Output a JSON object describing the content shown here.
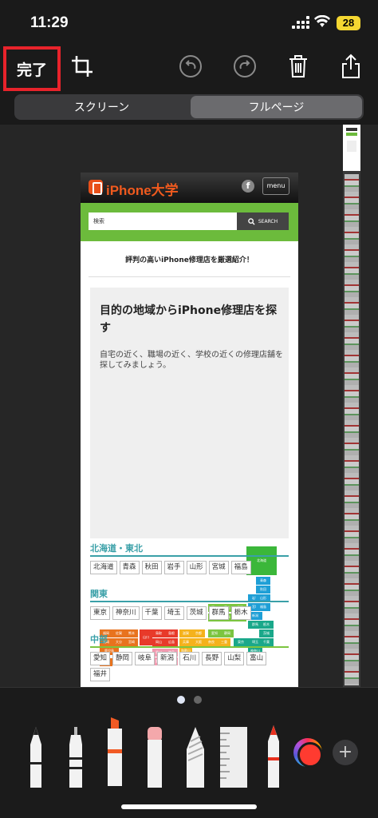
{
  "status_bar": {
    "time": "11:29",
    "battery": "28"
  },
  "toolbar": {
    "done_label": "完了"
  },
  "segments": {
    "screen": "スクリーン",
    "full_page": "フルページ"
  },
  "site": {
    "logo": "iPhone大学",
    "menu_label": "menu",
    "search_placeholder": "検索",
    "search_button": "SEARCH",
    "tagline": "評判の高いiPhone修理店を厳選紹介！",
    "map_title": "目的の地域からiPhone修理店を探す",
    "map_desc": "自宅の近く、職場の近く、学校の近くの修理店舗を探してみましょう。",
    "map_labels": [
      "北海道",
      "青森",
      "秋田",
      "岩手",
      "山形",
      "宮城",
      "福島",
      "新潟",
      "石川",
      "富山",
      "長野",
      "群馬",
      "栃木",
      "茨城",
      "福井",
      "岐阜",
      "山梨",
      "埼玉",
      "千葉",
      "東京",
      "神奈川",
      "静岡",
      "愛知",
      "滋賀",
      "京都",
      "兵庫",
      "大阪",
      "奈良",
      "三重",
      "和歌山",
      "鳥取",
      "島根",
      "岡山",
      "広島",
      "山口",
      "香川",
      "徳島",
      "愛媛",
      "高知",
      "福岡",
      "佐賀",
      "長崎",
      "大分",
      "熊本",
      "宮崎",
      "鹿児島",
      "沖縄"
    ],
    "regions": [
      {
        "name": "北海道・東北",
        "color": "#3aa0a8",
        "prefs": [
          "北海道",
          "青森",
          "秋田",
          "岩手",
          "山形",
          "宮城",
          "福島"
        ]
      },
      {
        "name": "関東",
        "color": "#3aa0a8",
        "prefs": [
          "東京",
          "神奈川",
          "千葉",
          "埼玉",
          "茨城",
          "群馬",
          "栃木"
        ]
      },
      {
        "name": "中部",
        "color": "#3aa0a8",
        "prefs": [
          "愛知",
          "静岡",
          "岐阜",
          "新潟",
          "石川",
          "長野",
          "山梨",
          "富山",
          "福井"
        ]
      }
    ]
  },
  "colors": {
    "done_highlight": "#e8232b",
    "accent_green": "#6cbb3c",
    "region_teal": "#3aa0a8"
  },
  "icons": [
    "crop-icon",
    "undo-icon",
    "redo-icon",
    "trash-icon",
    "share-icon"
  ],
  "tools": [
    "pen",
    "marker",
    "highlighter",
    "eraser",
    "lasso",
    "ruler",
    "pencil"
  ]
}
